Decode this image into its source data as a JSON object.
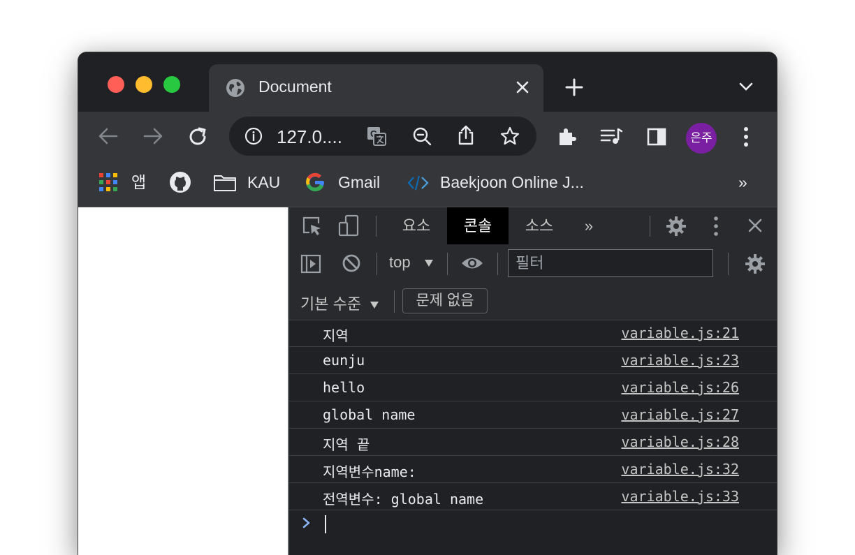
{
  "window": {
    "traffic_lights": {
      "close_color": "#ff5f57",
      "minimize_color": "#febc2e",
      "zoom_color": "#28c840"
    }
  },
  "tab": {
    "icon": "globe-icon",
    "title": "Document"
  },
  "toolbar": {
    "url": "127.0....",
    "profile_initials": "은주"
  },
  "bookmarks": [
    {
      "icon": "apps-grid-icon",
      "label": "앱"
    },
    {
      "icon": "github-icon",
      "label": ""
    },
    {
      "icon": "folder-icon",
      "label": "KAU"
    },
    {
      "icon": "google-icon",
      "label": "Gmail"
    },
    {
      "icon": "code-icon",
      "label": "Baekjoon Online J..."
    }
  ],
  "bookmarks_overflow": "»",
  "devtools": {
    "tabs": [
      {
        "label": "요소",
        "active": false
      },
      {
        "label": "콘솔",
        "active": true
      },
      {
        "label": "소스",
        "active": false
      }
    ],
    "more_tabs": "»",
    "context": "top",
    "filter_placeholder": "필터",
    "level": "기본 수준",
    "issues": "문제 없음",
    "messages": [
      {
        "text": "지역",
        "source": "variable.js:21"
      },
      {
        "text": "eunju",
        "source": "variable.js:23"
      },
      {
        "text": "hello",
        "source": "variable.js:26"
      },
      {
        "text": "global name",
        "source": "variable.js:27"
      },
      {
        "text": "지역 끝",
        "source": "variable.js:28"
      },
      {
        "text": "지역변수name:",
        "source": "variable.js:32"
      },
      {
        "text": "전역변수: global name",
        "source": "variable.js:33"
      }
    ],
    "accent_color": "#8ab4f8"
  }
}
